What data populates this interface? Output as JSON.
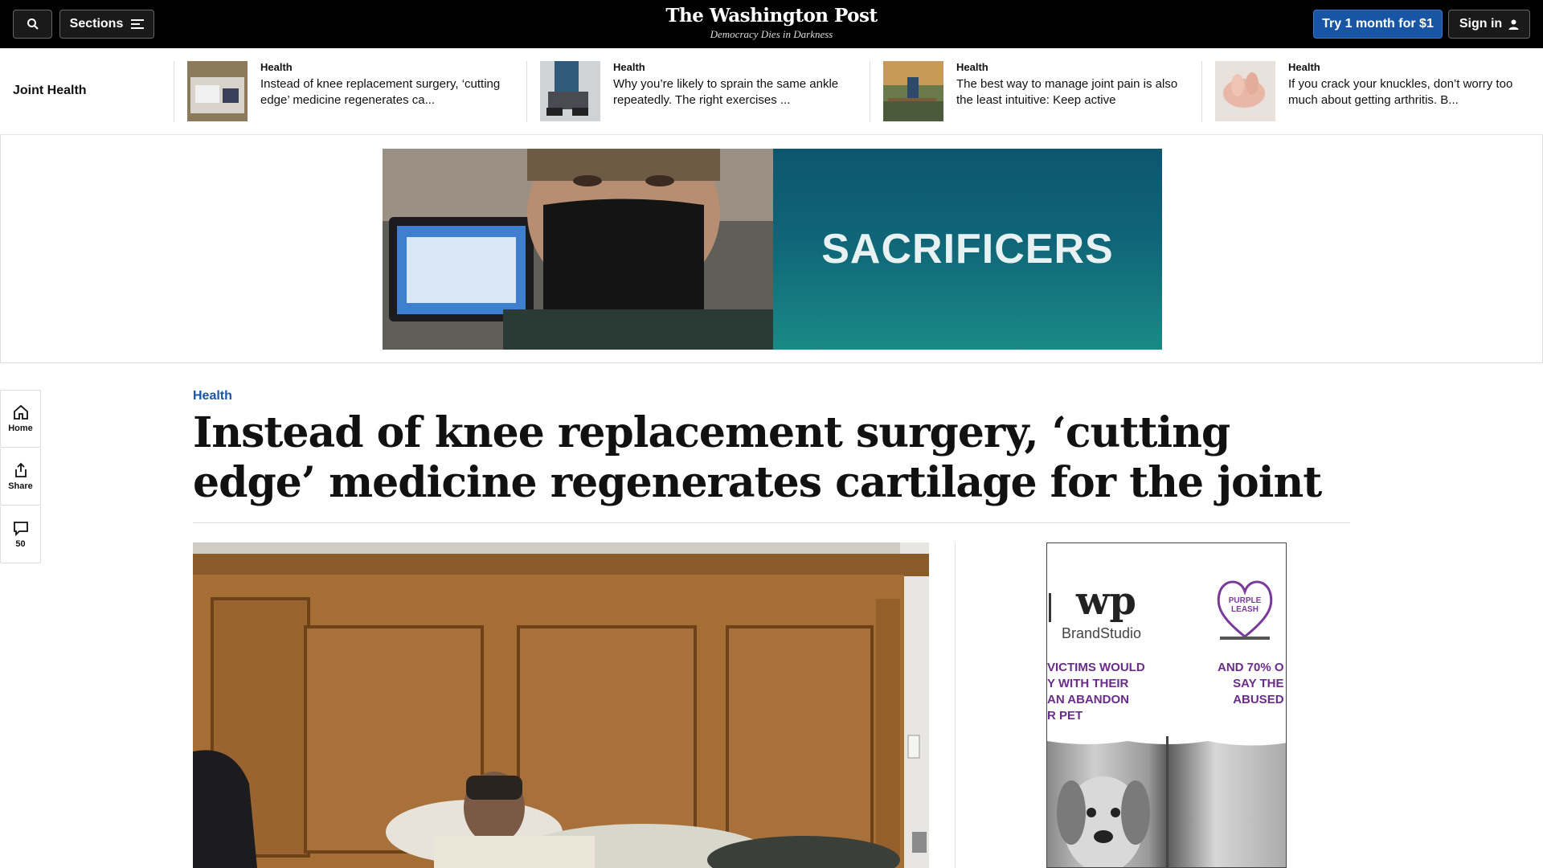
{
  "header": {
    "sections_label": "Sections",
    "logo_name": "The Washington Post",
    "logo_tagline": "Democracy Dies in Darkness",
    "try_label": "Try 1 month for $1",
    "signin_label": "Sign in"
  },
  "strip": {
    "label": "Joint Health",
    "cards": [
      {
        "kicker": "Health",
        "headline": "Instead of knee replacement surgery, ‘cutting edge’ medicine regenerates ca..."
      },
      {
        "kicker": "Health",
        "headline": "Why you’re likely to sprain the same ankle repeatedly. The right exercises ..."
      },
      {
        "kicker": "Health",
        "headline": "The best way to manage joint pain is also the least intuitive: Keep active"
      },
      {
        "kicker": "Health",
        "headline": "If you crack your knuckles, don’t worry too much about getting arthritis. B..."
      }
    ]
  },
  "ad_banner": {
    "headline": "SACRIFICERS"
  },
  "rail": {
    "home_label": "Home",
    "share_label": "Share",
    "comments_count": "50"
  },
  "article": {
    "kicker": "Health",
    "headline": "Instead of knee replacement surgery, ‘cutting edge’ medicine regenerates cartilage for the joint"
  },
  "side_ad": {
    "brand": "BrandStudio",
    "logo_text": "wp",
    "partner_line1": "PURPLE",
    "partner_line2": "LEASH",
    "left_text": [
      "VICTIMS WOULD",
      "Y WITH THEIR",
      "AN ABANDON",
      "R PET"
    ],
    "right_text": [
      "AND 70% O",
      "SAY THE",
      "ABUSED"
    ]
  }
}
